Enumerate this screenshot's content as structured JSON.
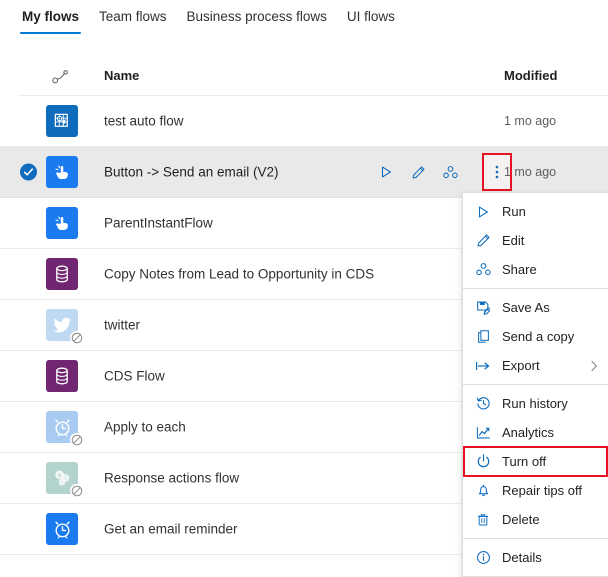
{
  "tabs": [
    {
      "label": "My flows",
      "active": true
    },
    {
      "label": "Team flows",
      "active": false
    },
    {
      "label": "Business process flows",
      "active": false
    },
    {
      "label": "UI flows",
      "active": false
    }
  ],
  "columns": {
    "link_icon": "flow-link-icon",
    "name": "Name",
    "modified": "Modified"
  },
  "rows": [
    {
      "name": "test auto flow",
      "modified": "1 mo ago",
      "icon": "automated-flow-icon",
      "icon_color": "#0f6cbd",
      "selected": false,
      "checked": false,
      "disabled": false
    },
    {
      "name": "Button -> Send an email (V2)",
      "modified": "1 mo ago",
      "icon": "instant-flow-icon",
      "icon_color": "#1a7bf0",
      "selected": true,
      "checked": true,
      "disabled": false
    },
    {
      "name": "ParentInstantFlow",
      "modified": "",
      "icon": "instant-flow-icon",
      "icon_color": "#1a7bf0",
      "selected": false,
      "checked": false,
      "disabled": false
    },
    {
      "name": "Copy Notes from Lead to Opportunity in CDS",
      "modified": "",
      "icon": "database-icon",
      "icon_color": "#702670",
      "selected": false,
      "checked": false,
      "disabled": false
    },
    {
      "name": "twitter",
      "modified": "",
      "icon": "twitter-icon",
      "icon_color": "#bfd9f2",
      "selected": false,
      "checked": false,
      "disabled": true
    },
    {
      "name": "CDS Flow",
      "modified": "",
      "icon": "database-icon",
      "icon_color": "#702670",
      "selected": false,
      "checked": false,
      "disabled": false
    },
    {
      "name": "Apply to each",
      "modified": "",
      "icon": "scheduled-flow-icon",
      "icon_color": "#a9cbf2",
      "selected": false,
      "checked": false,
      "disabled": true
    },
    {
      "name": "Response actions flow",
      "modified": "",
      "icon": "sharepoint-icon",
      "icon_color": "#b3d3cf",
      "selected": false,
      "checked": false,
      "disabled": true
    },
    {
      "name": "Get an email reminder",
      "modified": "",
      "icon": "scheduled-flow-icon",
      "icon_color": "#1a7bf0",
      "selected": false,
      "checked": false,
      "disabled": false
    }
  ],
  "row_actions": [
    {
      "label": "Run",
      "icon": "play-icon"
    },
    {
      "label": "Edit",
      "icon": "pencil-icon"
    },
    {
      "label": "Share",
      "icon": "share-icon"
    },
    {
      "label": "More commands",
      "icon": "more-vertical-icon"
    }
  ],
  "context_menu": {
    "items": [
      {
        "label": "Run",
        "icon": "play-icon",
        "divider_after": false,
        "submenu": false,
        "highlight": false
      },
      {
        "label": "Edit",
        "icon": "pencil-icon",
        "divider_after": false,
        "submenu": false,
        "highlight": false
      },
      {
        "label": "Share",
        "icon": "share-icon",
        "divider_after": true,
        "submenu": false,
        "highlight": false
      },
      {
        "label": "Save As",
        "icon": "save-as-icon",
        "divider_after": false,
        "submenu": false,
        "highlight": false
      },
      {
        "label": "Send a copy",
        "icon": "copy-icon",
        "divider_after": false,
        "submenu": false,
        "highlight": false
      },
      {
        "label": "Export",
        "icon": "export-icon",
        "divider_after": true,
        "submenu": true,
        "highlight": false
      },
      {
        "label": "Run history",
        "icon": "history-icon",
        "divider_after": false,
        "submenu": false,
        "highlight": false
      },
      {
        "label": "Analytics",
        "icon": "analytics-icon",
        "divider_after": false,
        "submenu": false,
        "highlight": false
      },
      {
        "label": "Turn off",
        "icon": "power-icon",
        "divider_after": false,
        "submenu": false,
        "highlight": true
      },
      {
        "label": "Repair tips off",
        "icon": "bell-icon",
        "divider_after": false,
        "submenu": false,
        "highlight": false
      },
      {
        "label": "Delete",
        "icon": "trash-icon",
        "divider_after": true,
        "submenu": false,
        "highlight": false
      },
      {
        "label": "Details",
        "icon": "info-icon",
        "divider_after": false,
        "submenu": false,
        "highlight": false
      }
    ]
  },
  "colors": {
    "accent": "#0078d4",
    "icon_blue": "#0f6cbd",
    "highlight_red": "#e81123",
    "selected_row": "#e9e9e9",
    "divider": "#edebe9"
  }
}
